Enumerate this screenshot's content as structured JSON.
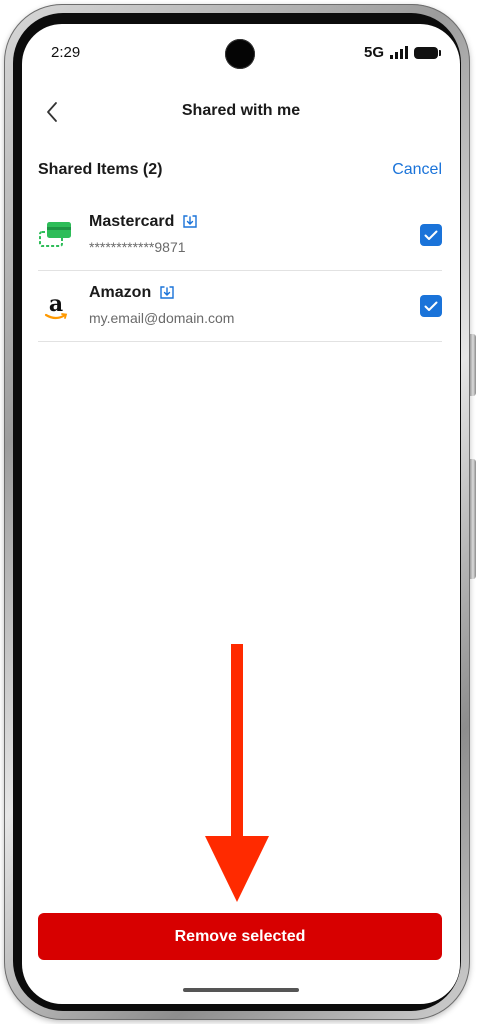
{
  "status_bar": {
    "time": "2:29",
    "network": "5G"
  },
  "header": {
    "title": "Shared with me"
  },
  "section": {
    "title": "Shared Items (2)",
    "cancel_label": "Cancel"
  },
  "items": [
    {
      "name": "Mastercard",
      "subtitle": "************9871",
      "checked": true
    },
    {
      "name": "Amazon",
      "subtitle": "my.email@domain.com",
      "checked": true
    }
  ],
  "footer": {
    "remove_label": "Remove selected"
  },
  "colors": {
    "accent": "#1a73d9",
    "danger": "#d70000",
    "card_green": "#2ebd59",
    "annotation_arrow": "#ff2a00"
  }
}
